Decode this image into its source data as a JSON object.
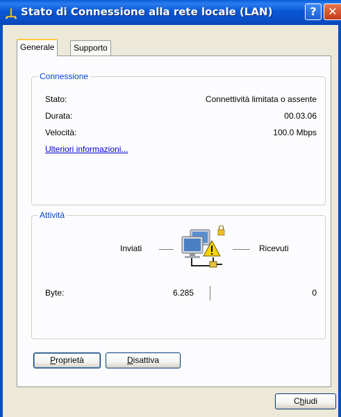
{
  "window": {
    "title": "Stato di Connessione alla rete locale (LAN)",
    "help_glyph": "?",
    "close_glyph": "✕"
  },
  "tabs": [
    {
      "label": "Generale",
      "active": true
    },
    {
      "label": "Supporto",
      "active": false
    }
  ],
  "connessione": {
    "heading": "Connessione",
    "rows": [
      {
        "label": "Stato:",
        "value": "Connettività limitata o assente"
      },
      {
        "label": "Durata:",
        "value": "00.03.06"
      },
      {
        "label": "Velocità:",
        "value": "100.0 Mbps"
      }
    ],
    "link_text": "Ulteriori informazioni..."
  },
  "attivita": {
    "heading": "Attività",
    "sent_label": "Inviati",
    "received_label": "Ricevuti",
    "bytes_label": "Byte:",
    "bytes_sent": "6.285",
    "bytes_received": "0"
  },
  "buttons": {
    "proprieta_first": "P",
    "proprieta_rest": "roprietà",
    "disattiva_first": "D",
    "disattiva_rest": "isattiva",
    "chiudi_pre": "C",
    "chiudi_ul": "h",
    "chiudi_post": "iudi"
  },
  "colors": {
    "title_bar": "#0A5EDB",
    "group_heading": "#0046D5",
    "link": "#0000CC",
    "warning": "#F5D300"
  }
}
